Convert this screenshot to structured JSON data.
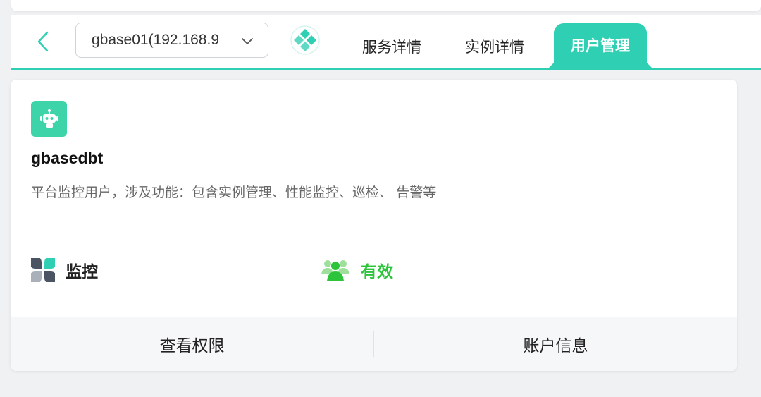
{
  "nav": {
    "back_icon": "chevron-left-icon",
    "instance_select": {
      "value": "gbase01(192.168.9"
    },
    "logo_icon": "gbase-diamond-logo",
    "tabs": [
      {
        "label": "服务详情",
        "active": false
      },
      {
        "label": "实例详情",
        "active": false
      },
      {
        "label": "用户管理",
        "active": true
      }
    ],
    "accent_color": "#2ecfb2"
  },
  "user_card": {
    "avatar_icon": "robot-icon",
    "name": "gbasedbt",
    "description": "平台监控用户，涉及功能：包含实例管理、性能监控、巡检、 告警等",
    "role": {
      "icon": "apps-grid-icon",
      "label": "监控"
    },
    "status": {
      "icon": "user-group-icon",
      "label": "有效",
      "color": "#2bc43a"
    },
    "actions": [
      {
        "label": "查看权限"
      },
      {
        "label": "账户信息"
      }
    ]
  }
}
